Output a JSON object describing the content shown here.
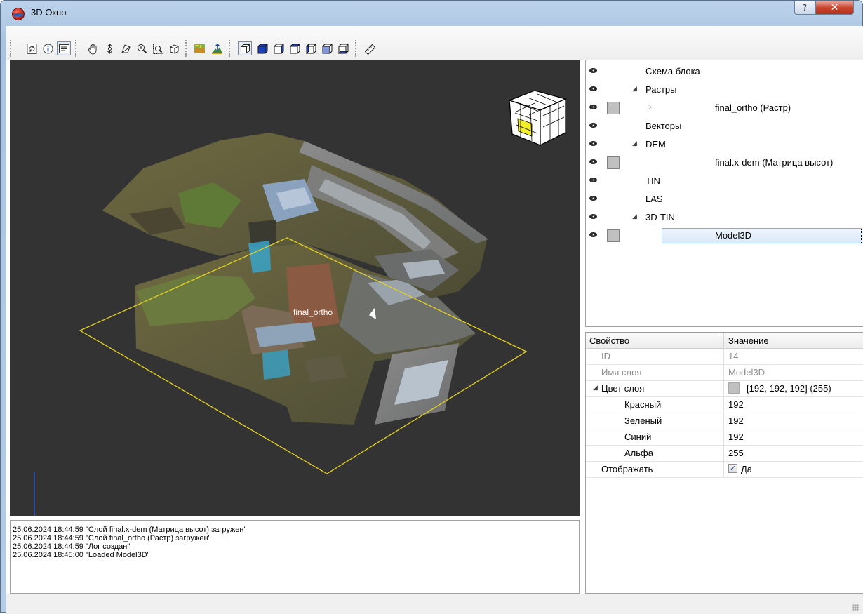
{
  "window": {
    "title": "3D Окно",
    "help_label": "?",
    "close_label": "✕"
  },
  "toolbar": {
    "groups": [
      [
        "refresh-icon",
        "info-icon",
        "properties-panel-icon"
      ],
      [
        "pan-hand-icon",
        "rotate-icon",
        "select-area-icon",
        "zoom-in-icon",
        "zoom-extent-icon",
        "cube-outline-icon"
      ],
      [
        "terrain-icon",
        "elevation-icon"
      ],
      [
        "perspective-cube-icon",
        "view-front-icon",
        "view-back-icon",
        "view-left-icon",
        "view-right-icon",
        "view-top-icon",
        "view-bottom-icon"
      ],
      [
        "ruler-icon"
      ]
    ]
  },
  "viewport": {
    "overlay_label": "final_ortho",
    "nav_cube_face_front": "front",
    "nav_cube_face_right": "left",
    "nav_cube_face_top": "top"
  },
  "log": {
    "lines": [
      "25.06.2024 18:44:59 \"Слой final.x-dem (Матрица высот) загружен\"",
      "25.06.2024 18:44:59 \"Слой final_ortho (Растр) загружен\"",
      "25.06.2024 18:44:59 \"Лог создан\"",
      "25.06.2024 18:45:00 \"Loaded Model3D\""
    ]
  },
  "tree": {
    "items": [
      {
        "label": "Схема блока",
        "level": 0,
        "expander": "",
        "swatch": false
      },
      {
        "label": "Растры",
        "level": 0,
        "expander": "open",
        "swatch": false
      },
      {
        "label": "final_ortho (Растр)",
        "level": 1,
        "expander": "closed",
        "swatch": true
      },
      {
        "label": "Векторы",
        "level": 0,
        "expander": "",
        "swatch": false
      },
      {
        "label": "DEM",
        "level": 0,
        "expander": "open",
        "swatch": false
      },
      {
        "label": "final.x-dem (Матрица высот)",
        "level": 1,
        "expander": "",
        "swatch": true
      },
      {
        "label": "TIN",
        "level": 0,
        "expander": "",
        "swatch": false
      },
      {
        "label": "LAS",
        "level": 0,
        "expander": "",
        "swatch": false
      },
      {
        "label": "3D-TIN",
        "level": 0,
        "expander": "open",
        "swatch": false
      },
      {
        "label": "Model3D",
        "level": 1,
        "expander": "",
        "swatch": true,
        "selected": true
      }
    ]
  },
  "props": {
    "header_name": "Свойство",
    "header_value": "Значение",
    "rows": [
      {
        "name": "ID",
        "value": "14",
        "muted": true,
        "indent": 0
      },
      {
        "name": "Имя слоя",
        "value": "Model3D",
        "muted": true,
        "indent": 0
      },
      {
        "name": "Цвет слоя",
        "value": "[192, 192, 192] (255)",
        "expander": "open",
        "indent": 0,
        "swatch": true
      },
      {
        "name": "Красный",
        "value": "192",
        "indent": 1
      },
      {
        "name": "Зеленый",
        "value": "192",
        "indent": 1
      },
      {
        "name": "Синий",
        "value": "192",
        "indent": 1
      },
      {
        "name": "Альфа",
        "value": "255",
        "indent": 1
      },
      {
        "name": "Отображать",
        "value": "Да",
        "checkbox": true,
        "checked": true,
        "indent": 0
      }
    ]
  },
  "colors": {
    "viewport_bg": "#333333",
    "raster_frame": "#e5d21f",
    "layer_swatch": "#c0c0c0",
    "selection": "#dbe9f9"
  }
}
